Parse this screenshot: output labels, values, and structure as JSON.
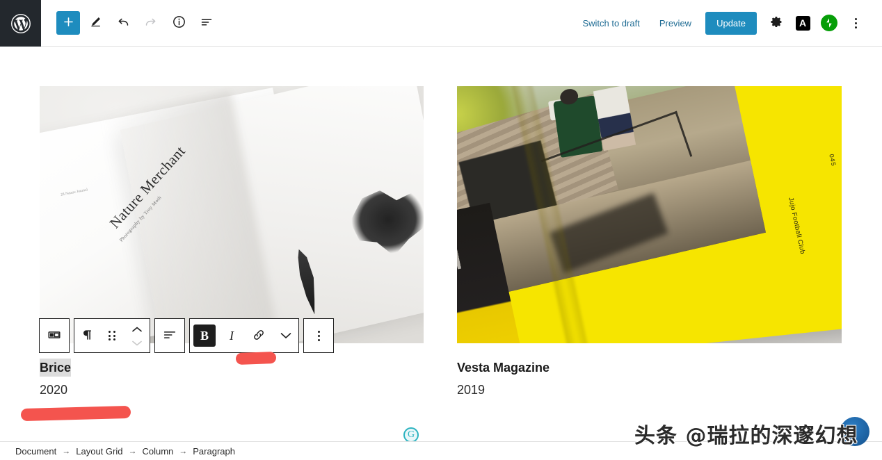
{
  "app": {
    "name": "WordPress Block Editor",
    "logo_icon": "wordpress-logo-icon"
  },
  "topbar": {
    "left_tools": [
      {
        "name": "add-block-button",
        "icon": "plus-icon",
        "label": "+",
        "state": "primary"
      },
      {
        "name": "edit-mode-button",
        "icon": "pencil-icon",
        "label": "",
        "state": "default"
      },
      {
        "name": "undo-button",
        "icon": "undo-arrow-icon",
        "label": "",
        "state": "default"
      },
      {
        "name": "redo-button",
        "icon": "redo-arrow-icon",
        "label": "",
        "state": "disabled"
      },
      {
        "name": "details-button",
        "icon": "info-circle-icon",
        "label": "",
        "state": "default"
      },
      {
        "name": "list-view-button",
        "icon": "list-view-icon",
        "label": "",
        "state": "default"
      }
    ],
    "switch_to_draft_label": "Switch to draft",
    "preview_label": "Preview",
    "update_label": "Update",
    "settings_icon": "gear-icon",
    "yoast_label": "A",
    "yoast_icon": "yoast-seo-icon",
    "jetpack_icon": "jetpack-bolt-icon",
    "more_options_icon": "kebab-menu-icon",
    "accent_color": "#1e8cbe",
    "link_color": "#1e6b93",
    "jetpack_color": "#069e08"
  },
  "block_toolbar": {
    "block_type": {
      "name": "layout-grid-block-icon",
      "label": "Layout Grid"
    },
    "paragraph_icon": "paragraph-pilcrow-icon",
    "drag_icon": "drag-handle-icon",
    "move_up_icon": "chevron-up-icon",
    "move_down_icon": "chevron-down-icon",
    "align_icon": "text-align-icon",
    "bold_label": "B",
    "bold_state": "active",
    "italic_label": "I",
    "link_icon": "link-icon",
    "more_rich_text_icon": "chevron-down-icon",
    "block_options_icon": "kebab-menu-icon"
  },
  "content": {
    "columns": [
      {
        "image": {
          "name": "book-spread-photo",
          "alt": "Open book spread photographed on a white surface",
          "book_title": "Nature Merchant",
          "book_subtitle": "Photography by Troy Moth",
          "book_folio": "28  Nature Journal"
        },
        "title": "Brice",
        "title_selected": true,
        "year": "2020"
      },
      {
        "image": {
          "name": "magazine-spread-photo",
          "alt": "Yellow magazine spread lying on a marble surface",
          "page_number": "045",
          "caption": "Jujo Football Club"
        },
        "title": "Vesta Magazine",
        "title_selected": false,
        "year": "2019"
      }
    ],
    "grammarly_badge": "G",
    "grammarly_color": "#2bb3c0"
  },
  "annotations": {
    "color": "#f4544e",
    "strokes": [
      {
        "name": "red-highlight-stroke-upper"
      },
      {
        "name": "red-highlight-stroke-lower"
      }
    ]
  },
  "breadcrumb": {
    "separator": "→",
    "items": [
      "Document",
      "Layout Grid",
      "Column",
      "Paragraph"
    ]
  },
  "watermark": {
    "text": "头条 @瑞拉的深邃幻想"
  }
}
